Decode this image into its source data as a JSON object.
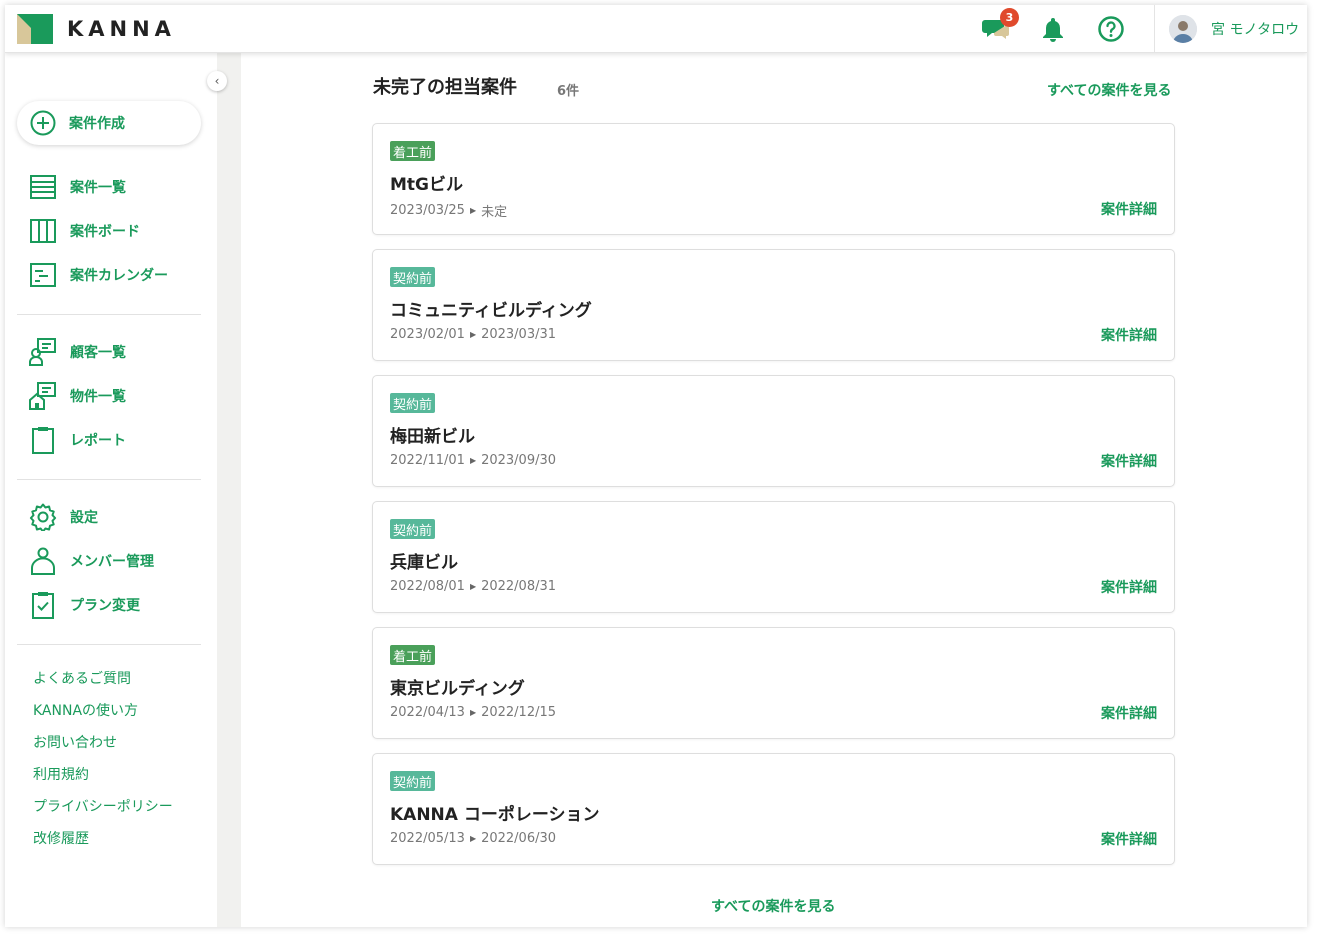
{
  "header": {
    "logo_text": "KANNA",
    "chat_badge": "3",
    "user_name": "宮 モノタロウ"
  },
  "sidebar": {
    "create": "案件作成",
    "nav1": [
      "案件一覧",
      "案件ボード",
      "案件カレンダー"
    ],
    "nav2": [
      "顧客一覧",
      "物件一覧",
      "レポート"
    ],
    "nav3": [
      "設定",
      "メンバー管理",
      "プラン変更"
    ],
    "links": [
      "よくあるご質問",
      "KANNAの使い方",
      "お問い合わせ",
      "利用規約",
      "プライバシーポリシー",
      "改修履歴"
    ]
  },
  "main": {
    "title": "未完了の担当案件",
    "count": "6件",
    "see_all": "すべての案件を見る",
    "detail_label": "案件詳細",
    "projects": [
      {
        "status": "着工前",
        "name": "MtGビル",
        "start": "2023/03/25",
        "end": "未定"
      },
      {
        "status": "契約前",
        "name": "コミュニティビルディング",
        "start": "2023/02/01",
        "end": "2023/03/31"
      },
      {
        "status": "契約前",
        "name": "梅田新ビル",
        "start": "2022/11/01",
        "end": "2023/09/30"
      },
      {
        "status": "契約前",
        "name": "兵庫ビル",
        "start": "2022/08/01",
        "end": "2022/08/31"
      },
      {
        "status": "着工前",
        "name": "東京ビルディング",
        "start": "2022/04/13",
        "end": "2022/12/15"
      },
      {
        "status": "契約前",
        "name": "KANNA コーポレーション",
        "start": "2022/05/13",
        "end": "2022/06/30"
      }
    ]
  },
  "colors": {
    "accent": "#1a9a5b",
    "status_before_construction": "#4aa05a",
    "status_before_contract": "#57b89a",
    "badge": "#e04a2c"
  }
}
